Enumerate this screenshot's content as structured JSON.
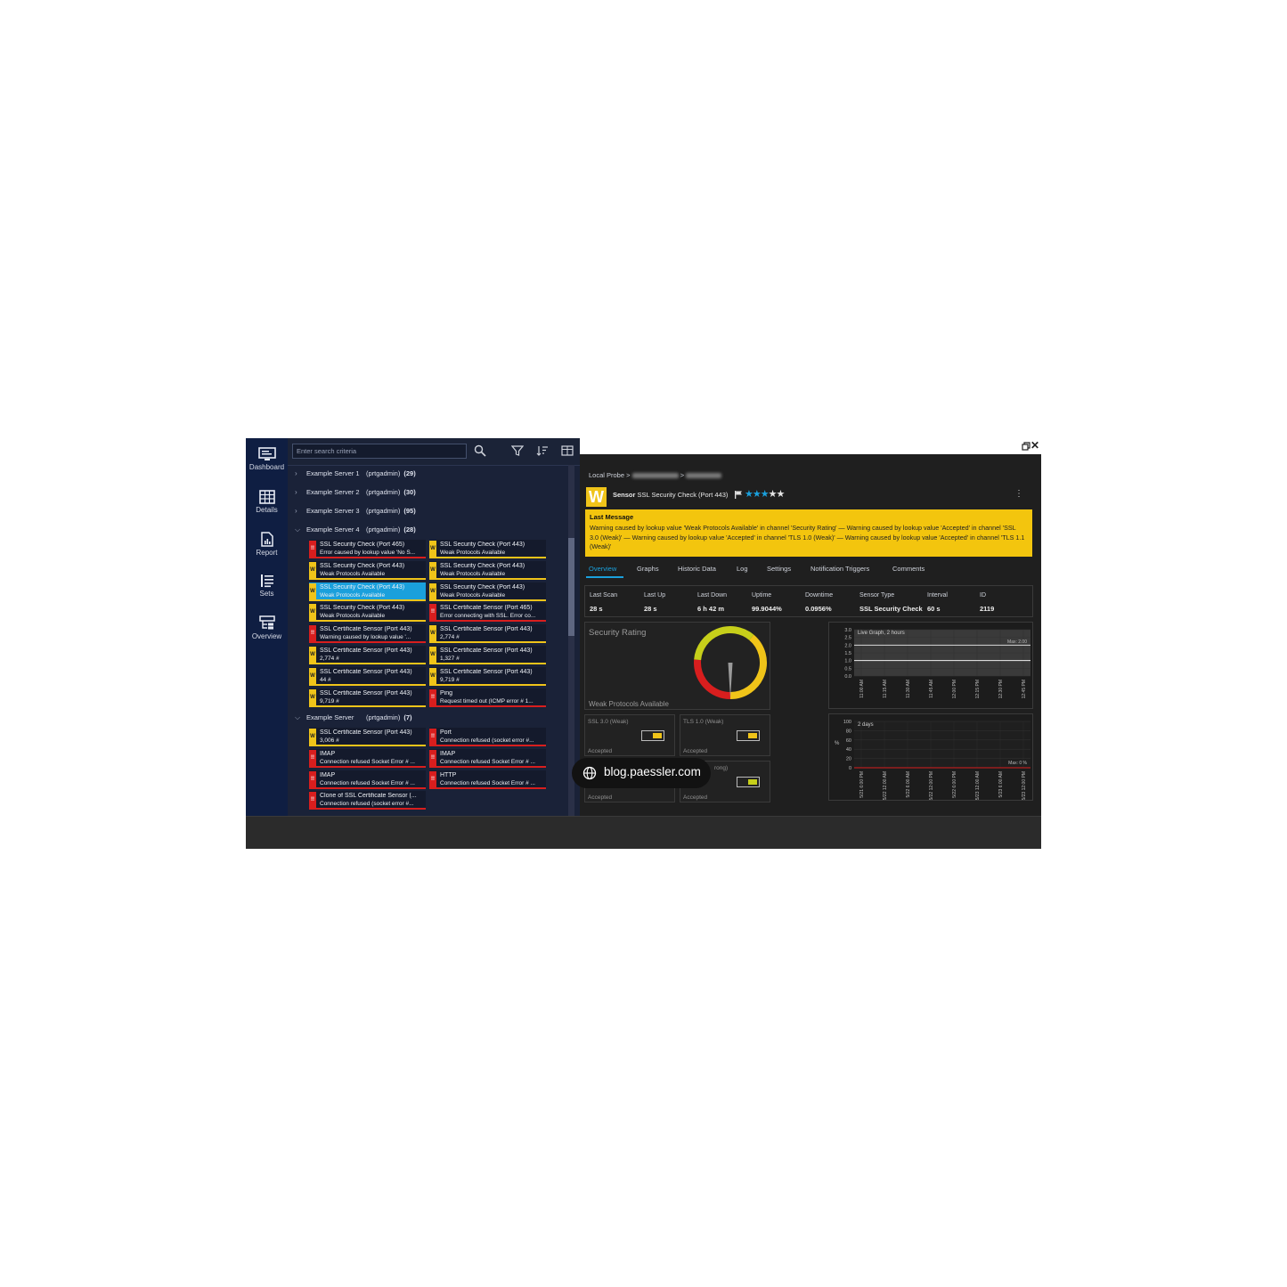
{
  "nav": {
    "items": [
      {
        "label": "Dashboard",
        "icon": "monitor-icon"
      },
      {
        "label": "Details",
        "icon": "table-grid-icon"
      },
      {
        "label": "Report",
        "icon": "report-document-icon"
      },
      {
        "label": "Sets",
        "icon": "list-icon"
      },
      {
        "label": "Overview",
        "icon": "overview-tree-icon"
      }
    ]
  },
  "toolbar": {
    "search_placeholder": "Enter search criteria",
    "icons": [
      "search-icon",
      "filter-icon",
      "sort-icon",
      "grid-view-icon"
    ]
  },
  "tree": {
    "groups": [
      {
        "name": "Example Server 1",
        "owner": "(prtgadmin)",
        "count": "(29)",
        "expanded": false
      },
      {
        "name": "Example Server 2",
        "owner": "(prtgadmin)",
        "count": "(30)",
        "expanded": false
      },
      {
        "name": "Example Server 3",
        "owner": "(prtgadmin)",
        "count": "(95)",
        "expanded": false
      },
      {
        "name": "Example Server 4",
        "owner": "(prtgadmin)",
        "count": "(28)",
        "expanded": true
      },
      {
        "name": "Example Server",
        "owner": "(prtgadmin)",
        "count": "(7)",
        "expanded": true
      }
    ],
    "server4_sensors": [
      {
        "name": "SSL Security Check (Port 465)",
        "msg": "Error caused by lookup value 'No S...",
        "status": "error"
      },
      {
        "name": "SSL Security Check (Port 443)",
        "msg": "Weak Protocols Available",
        "status": "warning"
      },
      {
        "name": "SSL Security Check (Port 443)",
        "msg": "Weak Protocols Available",
        "status": "warning"
      },
      {
        "name": "SSL Security Check (Port 443)",
        "msg": "Weak Protocols Available",
        "status": "warning"
      },
      {
        "name": "SSL Security Check (Port 443)",
        "msg": "Weak Protocols Available",
        "status": "selected"
      },
      {
        "name": "SSL Security Check (Port 443)",
        "msg": "Weak Protocols Available",
        "status": "warning"
      },
      {
        "name": "SSL Security Check (Port 443)",
        "msg": "Weak Protocols Available",
        "status": "warning"
      },
      {
        "name": "SSL Certificate Sensor (Port 465)",
        "msg": "Error connecting with SSL. Error co...",
        "status": "error"
      },
      {
        "name": "SSL Certificate Sensor (Port 443)",
        "msg": "Warning caused by lookup value '...",
        "status": "error"
      },
      {
        "name": "SSL Certificate Sensor (Port 443)",
        "msg": "2,774 #",
        "status": "warning"
      },
      {
        "name": "SSL Certificate Sensor (Port 443)",
        "msg": "2,774 #",
        "status": "warning"
      },
      {
        "name": "SSL Certificate Sensor (Port 443)",
        "msg": "1,327 #",
        "status": "warning"
      },
      {
        "name": "SSL Certificate Sensor (Port 443)",
        "msg": "44 #",
        "status": "warning"
      },
      {
        "name": "SSL Certificate Sensor (Port 443)",
        "msg": "9,719 #",
        "status": "warning"
      },
      {
        "name": "SSL Certificate Sensor (Port 443)",
        "msg": "9,719 #",
        "status": "warning"
      },
      {
        "name": "Ping",
        "msg": "Request timed out (ICMP error # 1...",
        "status": "error"
      }
    ],
    "server_sensors": [
      {
        "name": "SSL Certificate Sensor (Port 443)",
        "msg": "3,006 #",
        "status": "warning"
      },
      {
        "name": "Port",
        "msg": "Connection refused (socket error #...",
        "status": "error"
      },
      {
        "name": "IMAP",
        "msg": "Connection refused Socket Error # ...",
        "status": "error"
      },
      {
        "name": "IMAP",
        "msg": "Connection refused Socket Error # ...",
        "status": "error"
      },
      {
        "name": "IMAP",
        "msg": "Connection refused Socket Error # ...",
        "status": "error"
      },
      {
        "name": "HTTP",
        "msg": "Connection refused Socket Error # ...",
        "status": "error"
      },
      {
        "name": "Clone of SSL Certificate Sensor (...",
        "msg": "Connection refused (socket error #...",
        "status": "error"
      }
    ]
  },
  "detail": {
    "breadcrumb_start": "Local Probe >",
    "badge": "W",
    "sensor_prefix": "Sensor",
    "sensor_name": "SSL Security Check (Port 443)",
    "priority_stars": 3,
    "priority_max": 5,
    "last_message_title": "Last Message",
    "last_message_text": "Warning caused by lookup value 'Weak Protocols Available' in channel 'Security Rating' — Warning caused by lookup value 'Accepted' in channel 'SSL 3.0 (Weak)' — Warning caused by lookup value 'Accepted' in channel 'TLS 1.0 (Weak)' — Warning caused by lookup value 'Accepted' in channel 'TLS 1.1 (Weak)'",
    "tabs": [
      "Overview",
      "Graphs",
      "Historic Data",
      "Log",
      "Settings",
      "Notification Triggers",
      "Comments"
    ],
    "stats": [
      {
        "label": "Last Scan",
        "value": "28 s"
      },
      {
        "label": "Last Up",
        "value": "28 s"
      },
      {
        "label": "Last Down",
        "value": "6 h 42 m"
      },
      {
        "label": "Uptime",
        "value": "99.9044%"
      },
      {
        "label": "Downtime",
        "value": "0.0956%"
      },
      {
        "label": "Sensor Type",
        "value": "SSL Security Check"
      },
      {
        "label": "Interval",
        "value": "60 s"
      },
      {
        "label": "ID",
        "value": "2119"
      }
    ],
    "gauge": {
      "title": "Security Rating",
      "status": "Weak Protocols Available",
      "colors": [
        "#d81e1e",
        "#f0c419",
        "#c6cf1a"
      ]
    },
    "channels": [
      {
        "name": "SSL 3.0 (Weak)",
        "value": "Accepted"
      },
      {
        "name": "TLS 1.0 (Weak)",
        "value": "Accepted"
      },
      {
        "name": "",
        "value": "Accepted"
      },
      {
        "name": "rong)",
        "value": "Accepted"
      }
    ]
  },
  "chart_data": [
    {
      "type": "line",
      "title": "Live Graph, 2 hours",
      "y_ticks": [
        "3.0",
        "2.5",
        "2.0",
        "1.5",
        "1.0",
        "0.5",
        "0.0"
      ],
      "ylim": [
        0,
        3
      ],
      "x": [
        "11:00 AM",
        "11:15 AM",
        "11:30 AM",
        "11:45 AM",
        "12:00 PM",
        "12:15 PM",
        "12:30 PM",
        "12:45 PM"
      ],
      "annotation": "Max: 2.00",
      "series": [
        {
          "values": [
            2,
            2,
            2,
            2,
            2,
            2,
            2,
            2,
            2
          ]
        },
        {
          "values": [
            1,
            1,
            1,
            1,
            1,
            1,
            1,
            1,
            1
          ]
        }
      ]
    },
    {
      "type": "line",
      "title": "2 days",
      "ylabel": "%",
      "y_ticks": [
        "100",
        "80",
        "60",
        "40",
        "20",
        "0"
      ],
      "ylim": [
        0,
        100
      ],
      "x": [
        "5/21 6:00 PM",
        "5/22 12:00 AM",
        "5/22 6:00 AM",
        "5/22 12:00 PM",
        "5/22 6:00 PM",
        "5/23 12:00 AM",
        "5/23 6:00 AM",
        "5/23 12:00 PM"
      ],
      "annotation": "Max: 0 %",
      "series": [
        {
          "values": [
            0,
            0,
            0,
            0,
            0,
            0,
            0,
            0,
            0
          ]
        }
      ]
    }
  ],
  "watermark": "blog.paessler.com",
  "colors": {
    "warning": "#f0c419",
    "error": "#d81e1e",
    "selected": "#1aa0dc",
    "nav_bg": "#0f1e42"
  }
}
